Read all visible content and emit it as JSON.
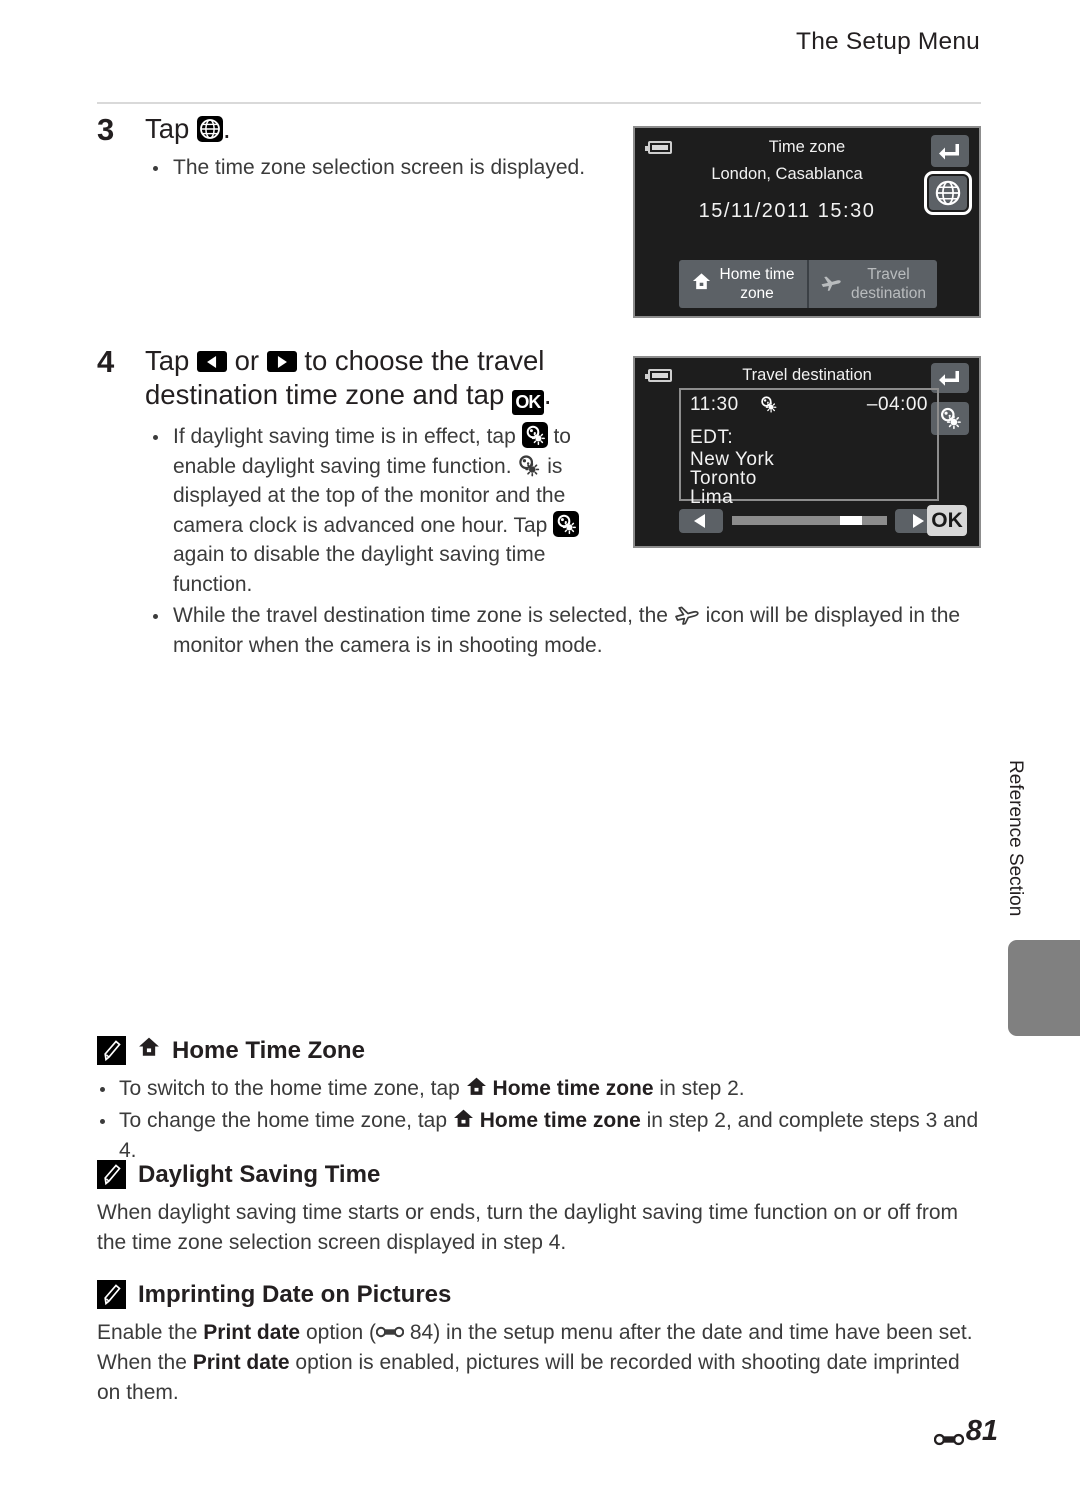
{
  "header": {
    "running_head": "The Setup Menu"
  },
  "steps": [
    {
      "number": "3",
      "title_pre": "Tap ",
      "title_post": ".",
      "bullets": [
        "The time zone selection screen is displayed."
      ]
    },
    {
      "number": "4",
      "title_a": "Tap ",
      "title_b": " or ",
      "title_c": " to choose the travel destination time zone and tap ",
      "title_d": ".",
      "bullet1": {
        "a": "If daylight saving time is in effect, tap ",
        "b": " to enable daylight saving time function. ",
        "c": " is displayed at the top of the monitor and the camera clock is advanced one hour. Tap ",
        "d": " again to disable the daylight saving time function."
      },
      "bullet2": {
        "a": "While the travel destination time zone is selected, the ",
        "b": " icon will be displayed in the monitor when the camera is in shooting mode."
      }
    }
  ],
  "screen1": {
    "title": "Time zone",
    "city": "London, Casablanca",
    "datetime": "15/11/2011 15:30",
    "tabs": [
      {
        "label_line1": "Home time",
        "label_line2": "zone",
        "icon": "house-icon",
        "active": true
      },
      {
        "label_line1": "Travel",
        "label_line2": "destination",
        "icon": "airplane-icon",
        "active": false
      }
    ],
    "back_button": "back-arrow-icon",
    "globe_button": "globe-icon"
  },
  "screen2": {
    "title": "Travel destination",
    "time": "11:30",
    "offset": "–04:00",
    "zone_abbrev": "EDT:",
    "cities": [
      "New York",
      "Toronto",
      "Lima"
    ],
    "prev_button": "left-arrow-icon",
    "next_button": "right-arrow-icon",
    "ok_button": "OK",
    "back_button": "back-arrow-icon",
    "dst_button": "daylight-saving-icon",
    "slider_position_pct": 70
  },
  "side_tab": {
    "label": "Reference Section"
  },
  "notes": [
    {
      "id": "home-time-zone",
      "heading": "Home Time Zone",
      "heading_has_house_icon": true,
      "bullets": [
        {
          "a": "To switch to the home time zone, tap ",
          "b": "Home time zone",
          "c": " in step 2."
        },
        {
          "a": "To change the home time zone, tap ",
          "b": "Home time zone",
          "c": " in step 2, and complete steps 3 and 4."
        }
      ]
    },
    {
      "id": "daylight-saving-time",
      "heading": "Daylight Saving Time",
      "heading_has_house_icon": false,
      "paragraph": "When daylight saving time starts or ends, turn the daylight saving time function on or off from the time zone selection screen displayed in step 4."
    },
    {
      "id": "imprinting-date-on-pictures",
      "heading": "Imprinting Date on Pictures",
      "heading_has_house_icon": false,
      "para_a": "Enable the ",
      "para_b": "Print date",
      "para_c": " option (",
      "para_ref": " 84) in the setup menu after the date and time have been set. When the ",
      "para_d": "Print date",
      "para_e": " option is enabled, pictures will be recorded with shooting date imprinted on them."
    }
  ],
  "folio": {
    "page": "81"
  },
  "colors": {
    "screen_bg": "#1d1d1d",
    "screen_border": "#8d8d8d",
    "button_gray": "#5c6166",
    "side_tab": "#808080",
    "rule": "#d9d9d9",
    "text": "#231f20"
  }
}
